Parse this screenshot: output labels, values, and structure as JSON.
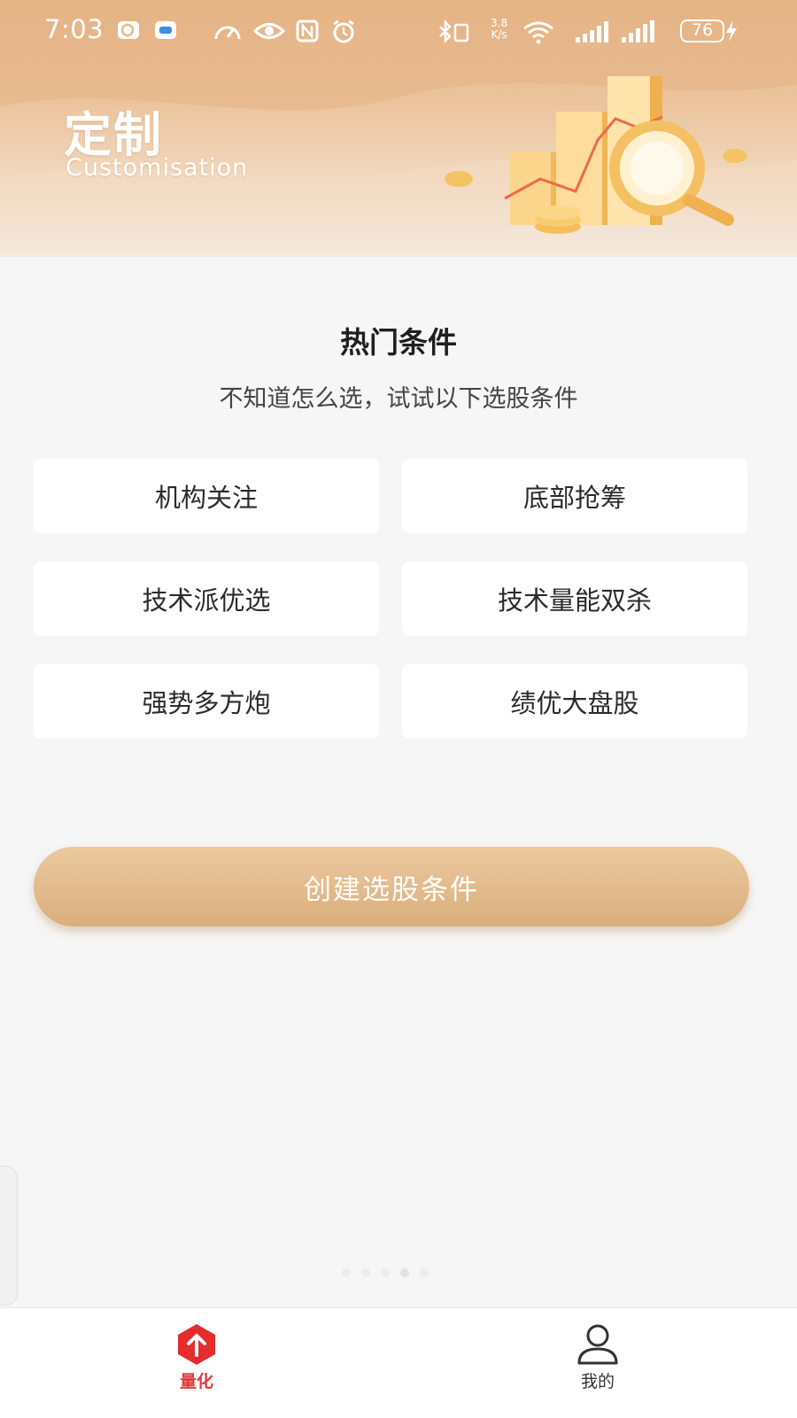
{
  "status_bar": {
    "time": "7:03",
    "net_speed_value": "3.8",
    "net_speed_unit": "K/s",
    "battery": "76"
  },
  "header": {
    "title": "定制",
    "subtitle": "Customisation"
  },
  "hot_conditions": {
    "title": "热门条件",
    "subtitle": "不知道怎么选，试试以下选股条件",
    "items": [
      {
        "label": "机构关注"
      },
      {
        "label": "底部抢筹"
      },
      {
        "label": "技术派优选"
      },
      {
        "label": "技术量能双杀"
      },
      {
        "label": "强势多方炮"
      },
      {
        "label": "绩优大盘股"
      }
    ]
  },
  "create_button": {
    "label": "创建选股条件"
  },
  "tab_bar": {
    "tabs": [
      {
        "label": "量化",
        "icon": "arrow-up-hexagon-icon",
        "active": true
      },
      {
        "label": "我的",
        "icon": "person-icon",
        "active": false
      }
    ]
  },
  "colors": {
    "accent_gold": "#d9ae7c",
    "active_tab_red": "#e03a3a",
    "background": "#f6f6f6"
  }
}
